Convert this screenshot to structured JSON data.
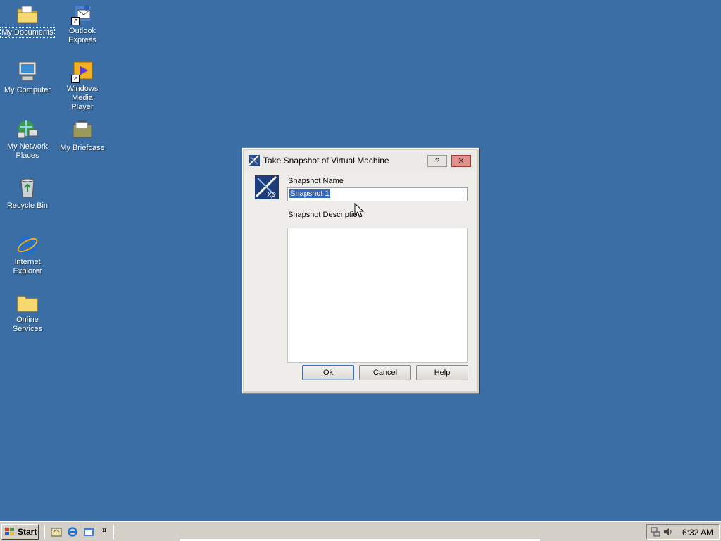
{
  "desktop": {
    "icons": [
      {
        "label_line1": "My Documents",
        "label_line2": ""
      },
      {
        "label_line1": "Outlook",
        "label_line2": "Express"
      },
      {
        "label_line1": "My Computer",
        "label_line2": ""
      },
      {
        "label_line1": "Windows Media",
        "label_line2": "Player"
      },
      {
        "label_line1": "My Network",
        "label_line2": "Places"
      },
      {
        "label_line1": "My Briefcase",
        "label_line2": ""
      },
      {
        "label_line1": "Recycle Bin",
        "label_line2": ""
      },
      {
        "label_line1": "Internet",
        "label_line2": "Explorer"
      },
      {
        "label_line1": "Online Services",
        "label_line2": ""
      }
    ],
    "background_color": "#3a6ea5"
  },
  "dialog": {
    "title": "Take Snapshot of Virtual Machine",
    "help_button": "?",
    "close_button": "✕",
    "name_label": "Snapshot Name",
    "name_value": "Snapshot 1",
    "description_label": "Snapshot Description",
    "description_value": "",
    "ok_label": "Ok",
    "cancel_label": "Cancel",
    "help_label": "Help"
  },
  "taskbar": {
    "start_label": "Start",
    "quicklaunch_more": "»",
    "clock": "6:32 AM"
  },
  "icons": {
    "dialog_title": "virtual-pc-icon",
    "dialog_big": "virtual-pc-xp-icon",
    "tray": [
      "network-icon",
      "volume-icon"
    ]
  },
  "colors": {
    "selection": "#316ac5",
    "taskbar": "#d4d0c8"
  }
}
